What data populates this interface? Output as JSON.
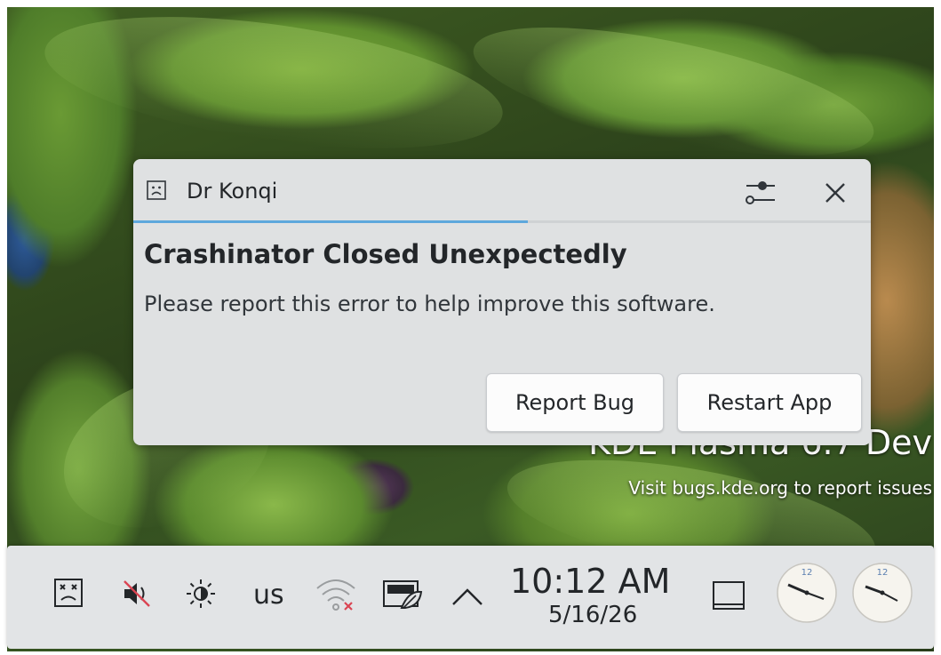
{
  "wallpaper": {
    "version_text": "KDE Plasma 6.7 Dev",
    "visit_text": "Visit bugs.kde.org to report issues"
  },
  "notification": {
    "app_name": "Dr Konqi",
    "app_icon": "sad-face-icon",
    "summary": "Crashinator Closed Unexpectedly",
    "body": "Please report this error to help improve this software.",
    "timeout_progress": 0.535,
    "actions": {
      "report": "Report Bug",
      "restart": "Restart App"
    },
    "colors": {
      "progress": "#5ea8dc",
      "background": "#dfe1e2"
    }
  },
  "panel": {
    "tray_icons": [
      "crash-notifier-icon",
      "volume-muted-icon",
      "brightness-icon",
      "keyboard-layout",
      "wifi-disconnected-icon",
      "power-profile-icon",
      "expand-tray-icon"
    ],
    "keyboard_layout": "us",
    "clock": {
      "time": "10:12 AM",
      "date": "5/16/26"
    },
    "extra_icons": [
      "show-desktop-icon",
      "analog-clock-icon",
      "analog-clock-icon"
    ]
  }
}
